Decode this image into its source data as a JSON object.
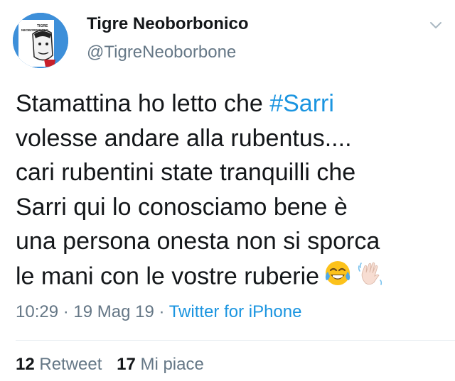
{
  "user": {
    "display_name": "Tigre Neoborbonico",
    "handle": "@TigreNeoborbone",
    "avatar_text_1": "TIGRE",
    "avatar_text_2": "NEOBORBONICO"
  },
  "tweet": {
    "lines": [
      {
        "before": "Stamattina ho letto che ",
        "hashtag": "#Sarri"
      },
      {
        "text": "volesse andare alla rubentus...."
      },
      {
        "text": "cari rubentini state tranquilli che"
      },
      {
        "text": "Sarri qui lo conosciamo bene è"
      },
      {
        "text": "una persona onesta non si sporca"
      },
      {
        "text": "le mani con le vostre ruberie"
      }
    ],
    "emojis": [
      "tears-of-joy-emoji",
      "waving-hand-emoji"
    ]
  },
  "meta": {
    "time": "10:29",
    "sep1": " · ",
    "date": "19 Mag 19",
    "sep2": " · ",
    "source": "Twitter for iPhone"
  },
  "stats": {
    "retweets_count": "12",
    "retweets_label": "Retweet",
    "likes_count": "17",
    "likes_label": "Mi piace"
  },
  "colors": {
    "link": "#1b95e0",
    "secondary": "#657786",
    "text": "#14171a"
  }
}
